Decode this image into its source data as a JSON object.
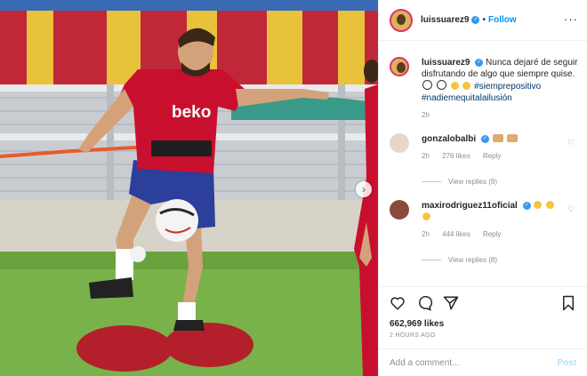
{
  "post": {
    "username": "luissuarez9",
    "follow_label": "Follow",
    "dot": "•",
    "more_icon": "more-options-icon",
    "caption_text": "Nunca dejaré de seguir disfrutando de algo que siempre quise.",
    "caption_hashtags": [
      "#siemprepositivo",
      "#nadiemequitalailusión"
    ],
    "caption_time": "2h",
    "jersey_sponsor": "beko",
    "likes": "662,969 likes",
    "posted_ago": "2 HOURS AGO",
    "add_comment_placeholder": "Add a comment...",
    "post_label": "Post"
  },
  "comments": [
    {
      "username": "gonzalobalbi",
      "time": "2h",
      "likes": "276 likes",
      "reply_label": "Reply",
      "view_replies": "View replies (9)"
    },
    {
      "username": "maxirodriguez11oficial",
      "time": "2h",
      "likes": "444 likes",
      "reply_label": "Reply",
      "view_replies": "View replies (8)"
    }
  ],
  "colors": {
    "link": "#0095f6",
    "verified": "#3897f0",
    "hashtag": "#00376b",
    "jersey": "#c8102e"
  }
}
